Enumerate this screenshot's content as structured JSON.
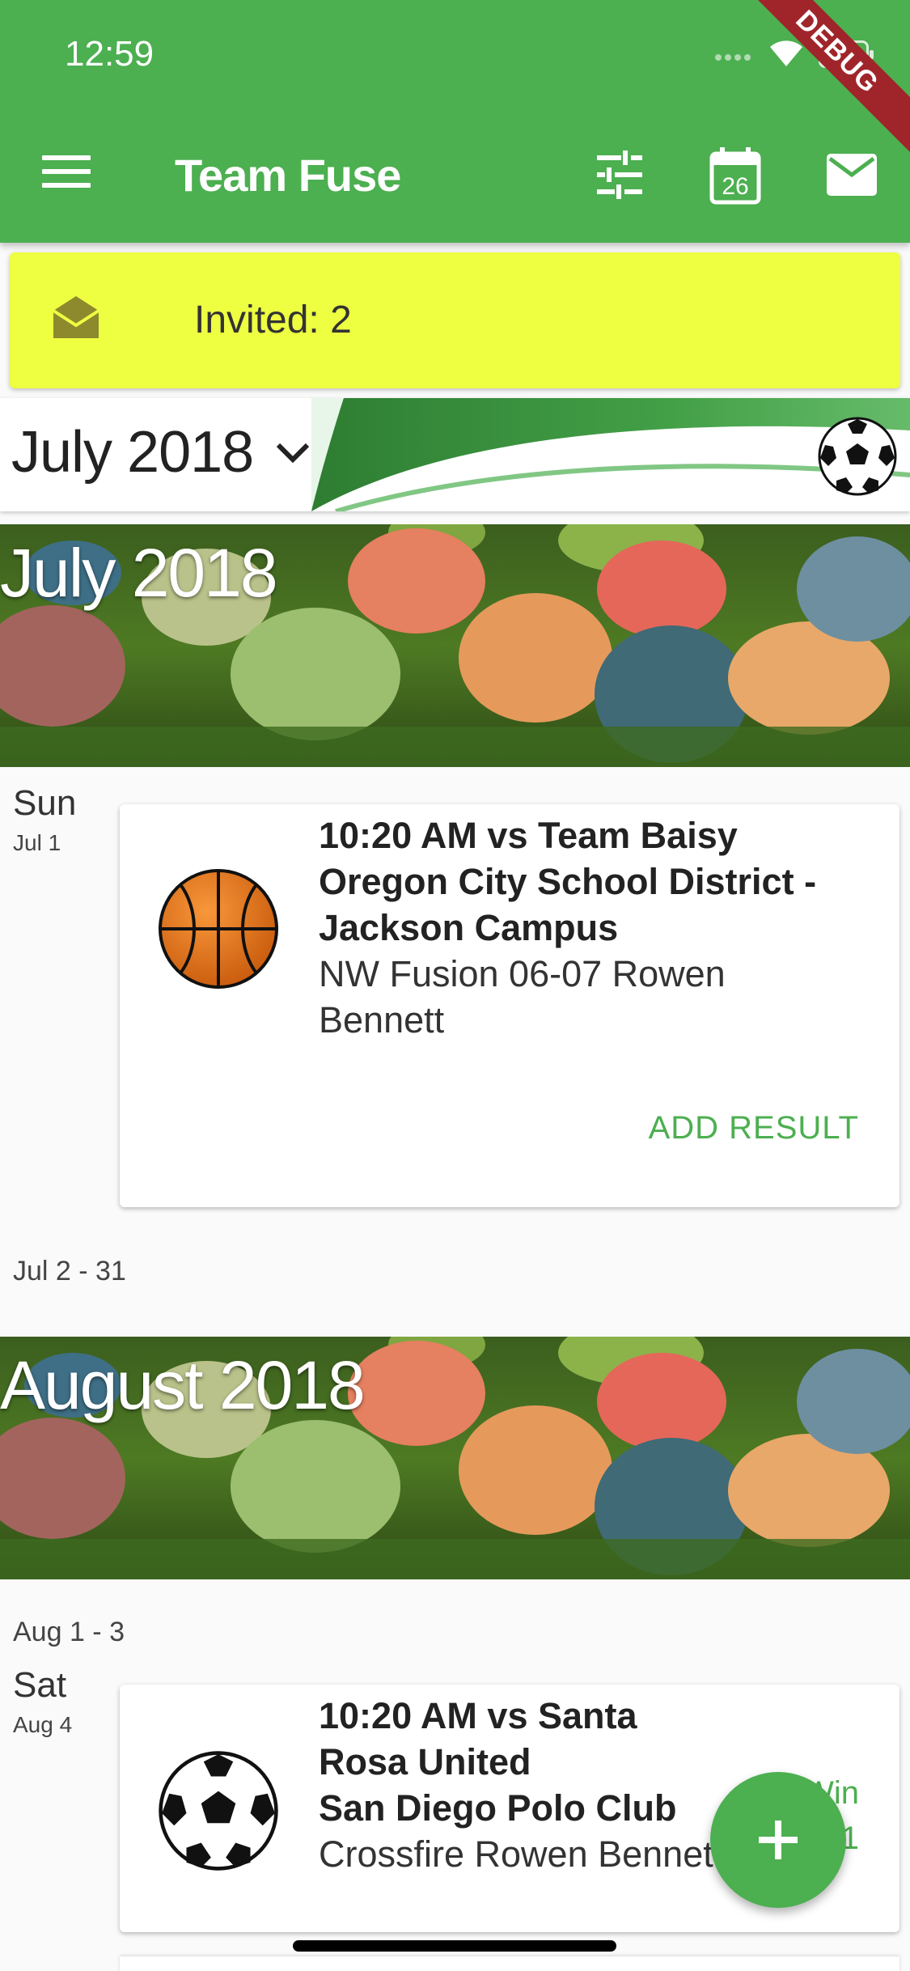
{
  "status_bar": {
    "time": "12:59",
    "debug_label": "DEBUG"
  },
  "app_bar": {
    "title": "Team Fuse",
    "icons": [
      "menu-icon",
      "tune-icon",
      "calendar-icon",
      "mail-icon"
    ],
    "calendar_day": "26"
  },
  "invite_banner": {
    "icon": "envelope-open-icon",
    "text": "Invited: 2"
  },
  "month_selector": {
    "label": "July 2018",
    "icon": "chevron-down-icon"
  },
  "months": [
    {
      "title": "July 2018",
      "days": [
        {
          "day_name": "Sun",
          "date": "Jul 1",
          "game": {
            "sport_icon": "basketball-icon",
            "title": "10:20 AM vs Team Baisy",
            "place": "Oregon City School District - Jackson Campus",
            "team": "NW Fusion 06-07 Rowen Bennett",
            "action": "ADD RESULT"
          }
        }
      ],
      "range_after": "Jul 2 - 31"
    },
    {
      "title": "August 2018",
      "range_before": "Aug 1 - 3",
      "days": [
        {
          "day_name": "Sat",
          "date": "Aug 4",
          "game": {
            "sport_icon": "soccer-ball-icon",
            "title": "10:20 AM vs Santa Rosa United",
            "place": "San Diego Polo Club",
            "team": "Crossfire Rowen Bennett",
            "result_label": "Win",
            "result_score": "1"
          }
        }
      ]
    }
  ],
  "fab": {
    "icon": "plus-icon"
  },
  "colors": {
    "primary": "#4caf50",
    "banner": "#eeff41",
    "debug": "#a0252a"
  }
}
